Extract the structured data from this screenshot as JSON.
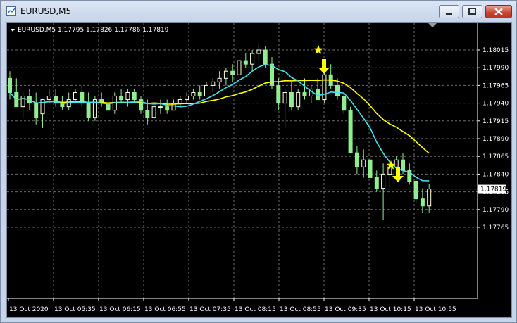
{
  "window": {
    "title": "EURUSD,M5"
  },
  "chart": {
    "header": "EURUSD,M5  1.17795 1.17826 1.17786 1.17819",
    "current_price": "1.17819",
    "price_levels": [
      "1.18015",
      "1.17990",
      "1.17965",
      "1.17940",
      "1.17915",
      "1.17890",
      "1.17865",
      "1.17840",
      "1.17815",
      "1.17790",
      "1.17765"
    ],
    "time_labels": [
      "13 Oct 2020",
      "13 Oct 05:35",
      "13 Oct 06:15",
      "13 Oct 06:55",
      "13 Oct 07:35",
      "13 Oct 08:15",
      "13 Oct 08:55",
      "13 Oct 09:35",
      "13 Oct 10:15",
      "13 Oct 10:55"
    ],
    "colors": {
      "background": "#000000",
      "grid": "#6b6b6b",
      "bull_candle": "#ffffe0",
      "bear_candle": "#90ee90",
      "fast_ma": "#40e0f0",
      "slow_ma": "#ffff00",
      "signal": "#ffff00"
    },
    "signals": [
      {
        "icon": "star-icon",
        "type": "sell-signal"
      },
      {
        "icon": "down-arrow-icon",
        "type": "sell-arrow"
      },
      {
        "icon": "star-icon",
        "type": "sell-signal"
      },
      {
        "icon": "down-arrow-icon",
        "type": "sell-arrow"
      }
    ]
  }
}
